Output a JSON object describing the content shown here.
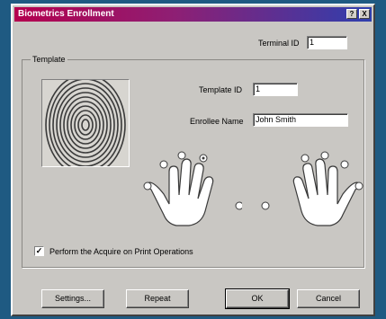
{
  "window": {
    "title": "Biometrics Enrollment"
  },
  "titlebar_buttons": {
    "help": "?",
    "close": "X"
  },
  "terminal": {
    "label": "Terminal ID",
    "value": "1"
  },
  "group": {
    "label": "Template",
    "template_id_label": "Template ID",
    "template_id_value": "1",
    "enrollee_label": "Enrollee Name",
    "enrollee_value": "John Smith"
  },
  "checkbox": {
    "label": "Perform the Acquire on Print Operations",
    "checked": true,
    "mark": "✓"
  },
  "buttons": {
    "settings": "Settings...",
    "repeat": "Repeat",
    "ok": "OK",
    "cancel": "Cancel"
  },
  "icons": {
    "fingerprint": "fingerprint-icon",
    "left_hand": "left-hand-icon",
    "right_hand": "right-hand-icon"
  }
}
